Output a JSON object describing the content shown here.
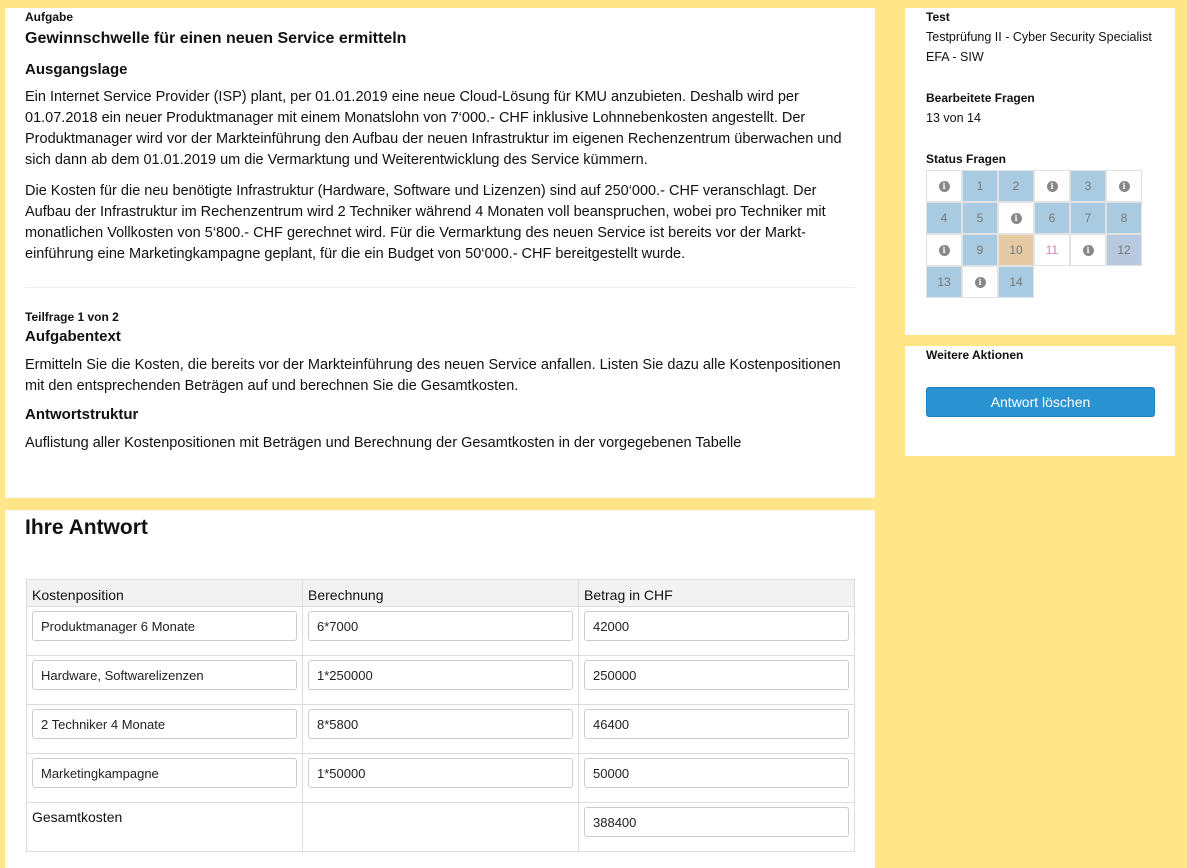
{
  "task": {
    "label": "Aufgabe",
    "title": "Gewinnschwelle für einen neuen Service ermitteln",
    "situation_heading": "Ausgangslage",
    "paragraphs": [
      "Ein Internet Service Provider (ISP) plant, per 01.01.2019 eine neue Cloud-Lösung für KMU anzubieten. Deshalb wird per 01.07.2018 ein neuer Produktmanager mit einem Monatslohn von 7‘000.- CHF inklusive Lohnnebenkosten angestellt. Der Produktmanager wird vor der Markteinführung den Aufbau der neuen Infrastruktur im eigenen Rechenzentrum überwachen und sich dann ab dem 01.01.2019 um die Vermarktung und Weiterentwicklung des Service kümmern.",
      "Die Kosten für die neu benötigte Infrastruktur (Hardware, Software und Lizenzen) sind auf 250‘000.- CHF veranschlagt. Der Aufbau der Infrastruktur im Rechenzentrum wird 2 Techniker während 4 Monaten voll beanspruchen, wobei pro Techniker mit monatlichen Vollkosten von 5‘800.- CHF gerechnet wird. Für die Vermarktung des neuen Service ist bereits vor der Markt-einführung eine Marketingkampagne geplant, für die ein Budget von 50‘000.- CHF bereitgestellt wurde."
    ],
    "subquestion_label": "Teilfrage 1 von 2",
    "task_text_heading": "Aufgabentext",
    "task_text": "Ermitteln Sie die Kosten, die bereits vor der Markteinführung des neuen Service anfallen. Listen Sie dazu alle Kostenpositionen mit den entsprechenden Beträgen auf und berechnen Sie die Gesamtkosten.",
    "structure_heading": "Antwortstruktur",
    "structure_text": "Auflistung aller Kostenpositionen mit Beträgen und Berechnung der Gesamtkosten in der vorgegebenen Tabelle"
  },
  "answer": {
    "title": "Ihre Antwort",
    "columns": [
      "Kostenposition",
      "Berechnung",
      "Betrag in CHF"
    ],
    "rows": [
      {
        "position": "Produktmanager 6 Monate",
        "calc": "6*7000",
        "amount": "42000"
      },
      {
        "position": "Hardware, Softwarelizenzen",
        "calc": "1*250000",
        "amount": "250000"
      },
      {
        "position": "2 Techniker 4 Monate",
        "calc": "8*5800",
        "amount": "46400"
      },
      {
        "position": "Marketingkampagne",
        "calc": "1*50000",
        "amount": "50000"
      }
    ],
    "total_label": "Gesamtkosten",
    "total_amount": "388400"
  },
  "sidebar": {
    "test_label": "Test",
    "test_name_line1": "Testprüfung II - Cyber Security Specialist",
    "test_name_line2": "EFA - SIW",
    "edited_label": "Bearbeitete Fragen",
    "edited_value": "13 von 14",
    "status_label": "Status Fragen",
    "info_glyph": "i",
    "status_cells": [
      {
        "type": "info"
      },
      {
        "type": "answered",
        "text": "1"
      },
      {
        "type": "answered",
        "text": "2"
      },
      {
        "type": "info"
      },
      {
        "type": "answered",
        "text": "3"
      },
      {
        "type": "info"
      },
      {
        "type": "answered",
        "text": "4"
      },
      {
        "type": "answered",
        "text": "5"
      },
      {
        "type": "info"
      },
      {
        "type": "answered",
        "text": "6"
      },
      {
        "type": "answered",
        "text": "7"
      },
      {
        "type": "answered",
        "text": "8"
      },
      {
        "type": "info"
      },
      {
        "type": "answered",
        "text": "9"
      },
      {
        "type": "current",
        "text": "10"
      },
      {
        "type": "open",
        "text": "11"
      },
      {
        "type": "info"
      },
      {
        "type": "answered-alt",
        "text": "12"
      },
      {
        "type": "answered",
        "text": "13"
      },
      {
        "type": "info"
      },
      {
        "type": "answered",
        "text": "14"
      }
    ],
    "status_colors": {
      "answered": "#a9cbe1",
      "current": "#e5c9a2",
      "open": "#ffffff",
      "answered-alt": "#b8c8df"
    },
    "actions_label": "Weitere Aktionen",
    "delete_button": "Antwort löschen"
  }
}
